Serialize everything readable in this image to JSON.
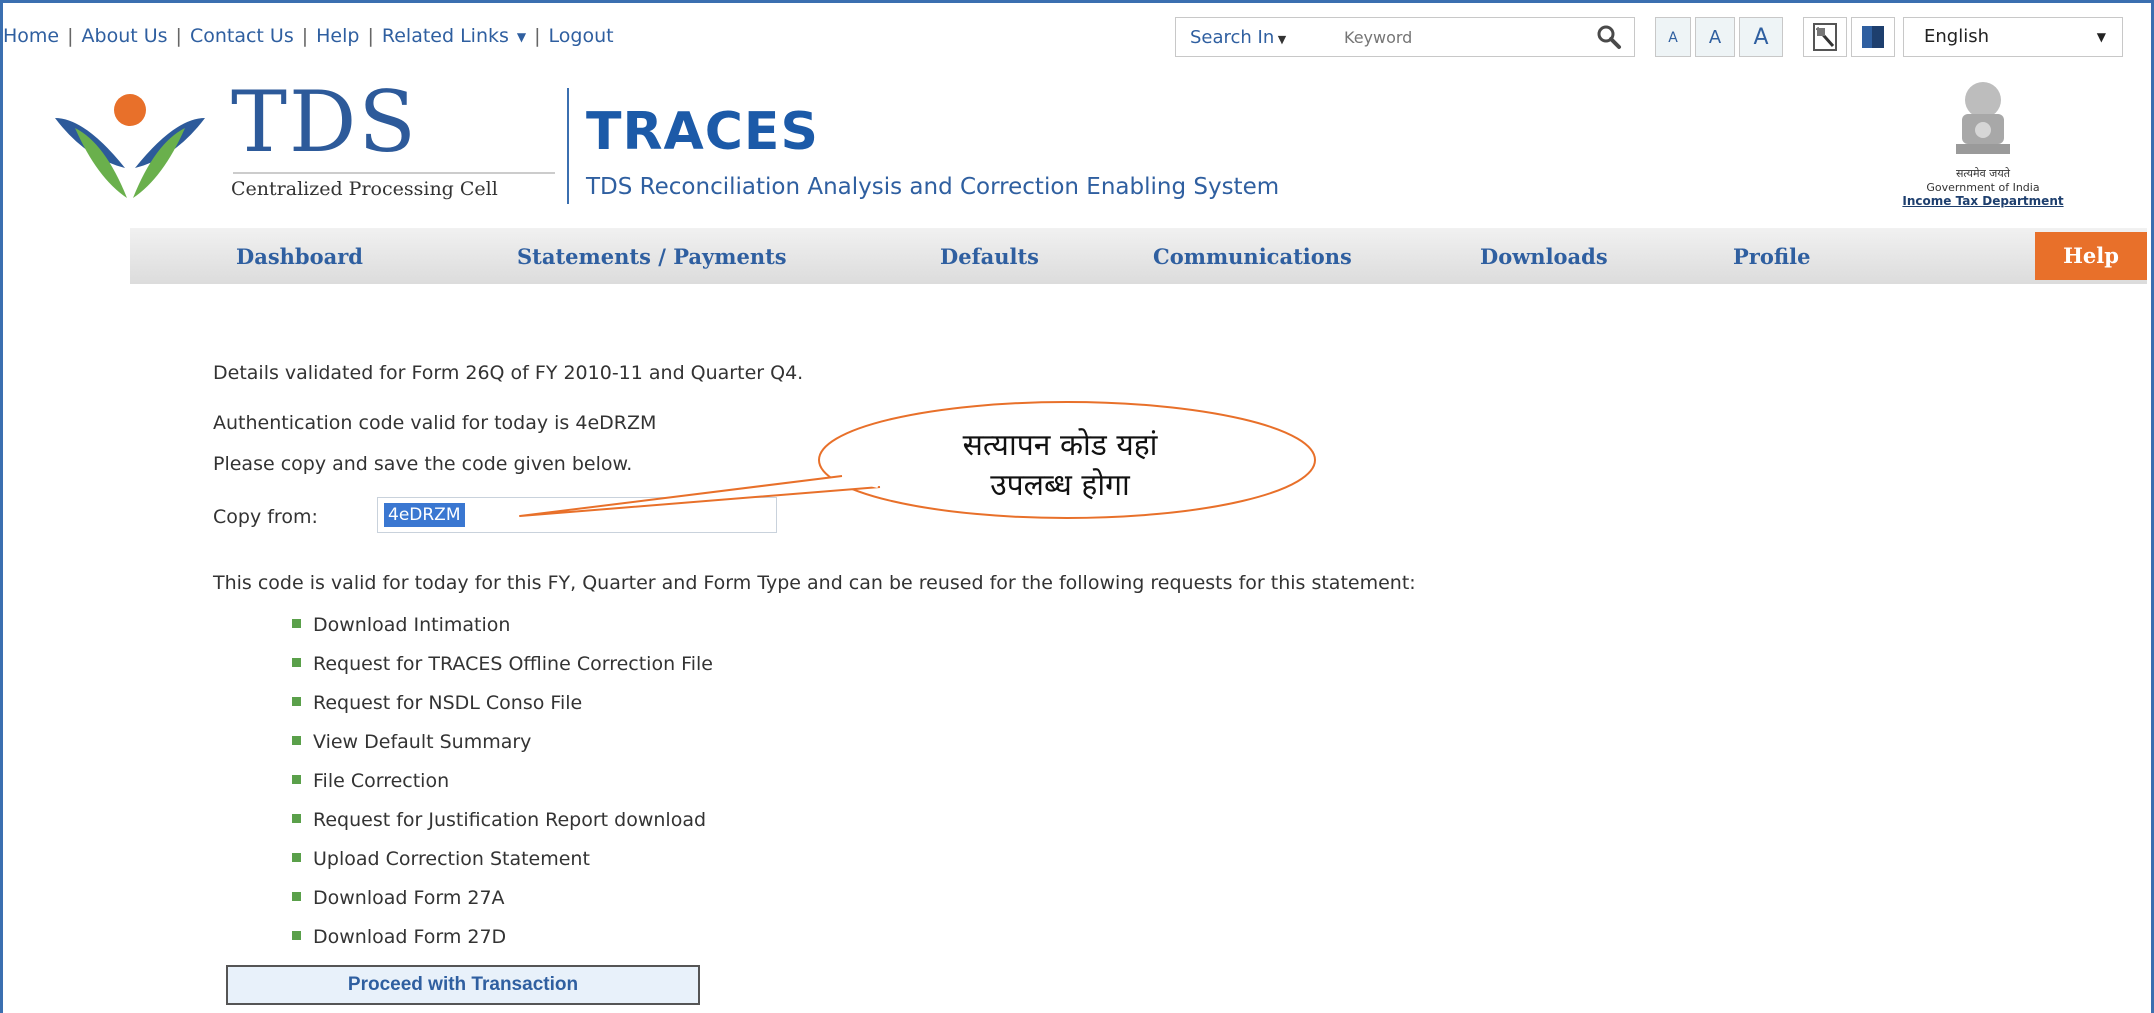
{
  "toplinks": {
    "home": "Home",
    "about": "About Us",
    "contact": "Contact Us",
    "help": "Help",
    "related": "Related Links",
    "logout": "Logout"
  },
  "search": {
    "label": "Search In",
    "placeholder": "Keyword"
  },
  "font_controls": [
    "A",
    "A",
    "A"
  ],
  "language": "English",
  "header": {
    "tds": "TDS",
    "cpc": "Centralized Processing Cell",
    "traces": "TRACES",
    "traces_sub": "TDS Reconciliation Analysis and Correction Enabling System",
    "gov_hindi": "सत्यमेव जयते",
    "gov_india": "Government of India",
    "dept": "Income Tax Department"
  },
  "nav": {
    "dashboard": "Dashboard",
    "statements": "Statements / Payments",
    "defaults": "Defaults",
    "communications": "Communications",
    "downloads": "Downloads",
    "profile": "Profile",
    "help": "Help"
  },
  "content": {
    "validated": "Details validated for Form 26Q of FY 2010-11 and Quarter Q4.",
    "auth": "Authentication code valid for today is 4eDRZM",
    "please_copy": "Please copy and save the code given below.",
    "copy_from": "Copy from:",
    "code": "4eDRZM",
    "valid_note": "This code is valid for today for this FY, Quarter and Form Type and can be reused for the following requests for this statement:",
    "requests": [
      "Download Intimation",
      "Request for TRACES Offline Correction File",
      "Request for NSDL Conso File",
      "View Default Summary",
      "File Correction",
      "Request for Justification Report download",
      "Upload Correction Statement",
      "Download Form 27A",
      "Download Form 27D"
    ],
    "proceed": "Proceed with Transaction"
  },
  "callout": {
    "line1": "सत्यापन कोड यहां",
    "line2": "उपलब्ध होगा"
  },
  "colors": {
    "link_blue": "#2f5fa0",
    "traces_blue": "#1c5aa8",
    "help_orange": "#e8702a",
    "callout_orange": "#e8702a",
    "bullet_green": "#5aa04a"
  }
}
